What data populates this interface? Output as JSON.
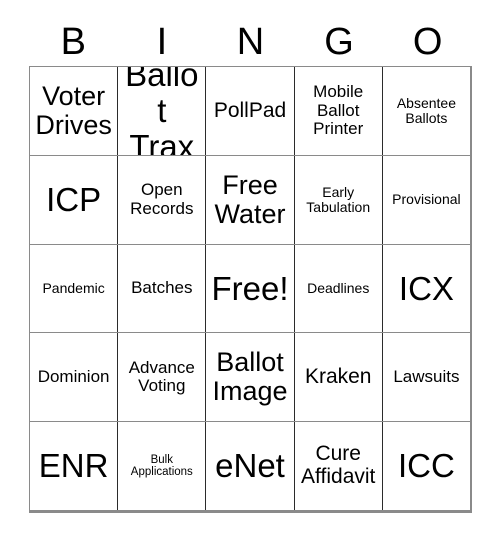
{
  "card": {
    "title_letters": [
      "B",
      "I",
      "N",
      "G",
      "O"
    ],
    "free_space_label": "Free!",
    "colors": {
      "background": "#ffffff",
      "text": "#000000",
      "grid_line": "#2b2b2b",
      "outer_border": "#8a8a8a"
    },
    "rows": [
      [
        {
          "text": "Voter Drives",
          "size": "lg"
        },
        {
          "text": "Ballot Trax",
          "size": "xl"
        },
        {
          "text": "PollPad",
          "size": "md"
        },
        {
          "text": "Mobile Ballot Printer",
          "size": "sm"
        },
        {
          "text": "Absentee Ballots",
          "size": "xs"
        }
      ],
      [
        {
          "text": "ICP",
          "size": "xl"
        },
        {
          "text": "Open Records",
          "size": "sm"
        },
        {
          "text": "Free Water",
          "size": "lg"
        },
        {
          "text": "Early Tabulation",
          "size": "xs"
        },
        {
          "text": "Provisional",
          "size": "xs"
        }
      ],
      [
        {
          "text": "Pandemic",
          "size": "xs"
        },
        {
          "text": "Batches",
          "size": "sm"
        },
        {
          "text": "Free!",
          "size": "xl"
        },
        {
          "text": "Deadlines",
          "size": "xs"
        },
        {
          "text": "ICX",
          "size": "xl"
        }
      ],
      [
        {
          "text": "Dominion",
          "size": "sm"
        },
        {
          "text": "Advance Voting",
          "size": "sm"
        },
        {
          "text": "Ballot Image",
          "size": "lg"
        },
        {
          "text": "Kraken",
          "size": "md"
        },
        {
          "text": "Lawsuits",
          "size": "sm"
        }
      ],
      [
        {
          "text": "ENR",
          "size": "xl"
        },
        {
          "text": "Bulk Applications",
          "size": "xxs"
        },
        {
          "text": "eNet",
          "size": "xl"
        },
        {
          "text": "Cure Affidavit",
          "size": "md"
        },
        {
          "text": "ICC",
          "size": "xl"
        }
      ]
    ]
  }
}
